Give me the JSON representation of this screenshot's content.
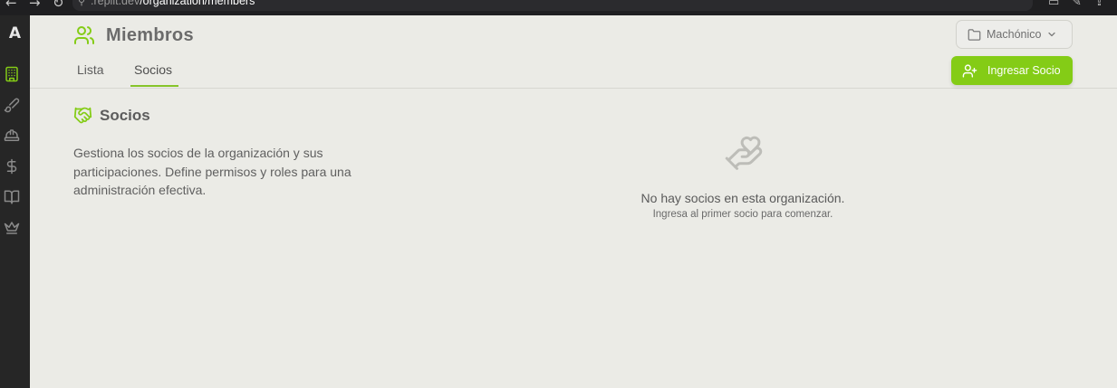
{
  "browser": {
    "url_prefix": ".replit.dev",
    "url_path": "/organization/members"
  },
  "sidebar": {
    "logo": "A",
    "items": [
      {
        "icon": "building-icon",
        "active": true
      },
      {
        "icon": "brush-icon",
        "active": false
      },
      {
        "icon": "hardhat-icon",
        "active": false
      },
      {
        "icon": "dollar-icon",
        "active": false
      },
      {
        "icon": "book-icon",
        "active": false
      },
      {
        "icon": "crown-icon",
        "active": false
      }
    ]
  },
  "header": {
    "title": "Miembros",
    "org_selector": "Machónico",
    "tabs": [
      {
        "label": "Lista",
        "active": false
      },
      {
        "label": "Socios",
        "active": true
      }
    ],
    "add_button": "Ingresar Socio"
  },
  "section": {
    "title": "Socios",
    "description": "Gestiona los socios de la organización y sus participaciones. Define permisos y roles para una administración efectiva."
  },
  "empty_state": {
    "title": "No hay socios en esta organización.",
    "subtitle": "Ingresa al primer socio para comenzar."
  },
  "colors": {
    "accent": "#84cc16",
    "sidebar_bg": "#262626",
    "page_bg": "#ebebe6"
  }
}
